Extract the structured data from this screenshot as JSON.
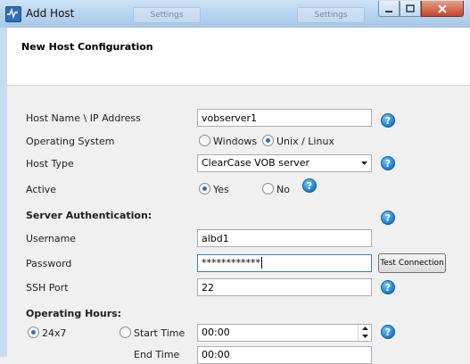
{
  "window": {
    "title": "Add Host",
    "ghost_tabs": [
      "Settings",
      "Settings"
    ],
    "controls": [
      "minimize-icon",
      "maximize-icon",
      "close-icon"
    ]
  },
  "header": {
    "title": "New Host Configuration"
  },
  "form": {
    "host_name_label": "Host Name \\ IP Address",
    "host_name_value": "vobserver1",
    "os_label": "Operating System",
    "os_options": [
      "Windows",
      "Unix / Linux"
    ],
    "os_selected": "Unix / Linux",
    "host_type_label": "Host Type",
    "host_type_value": "ClearCase VOB server",
    "active_label": "Active",
    "active_options": [
      "Yes",
      "No"
    ],
    "active_selected": "Yes",
    "server_auth_label": "Server Authentication:",
    "username_label": "Username",
    "username_value": "albd1",
    "password_label": "Password",
    "password_value": "************",
    "test_connection_label": "Test Connection",
    "ssh_port_label": "SSH Port",
    "ssh_port_value": "22",
    "operating_hours_label": "Operating Hours:",
    "hours_options": [
      "24x7",
      "Start Time"
    ],
    "hours_selected": "24x7",
    "start_time_value": "00:00",
    "end_time_label": "End Time",
    "end_time_value": "00:00",
    "help_glyph": "?"
  }
}
